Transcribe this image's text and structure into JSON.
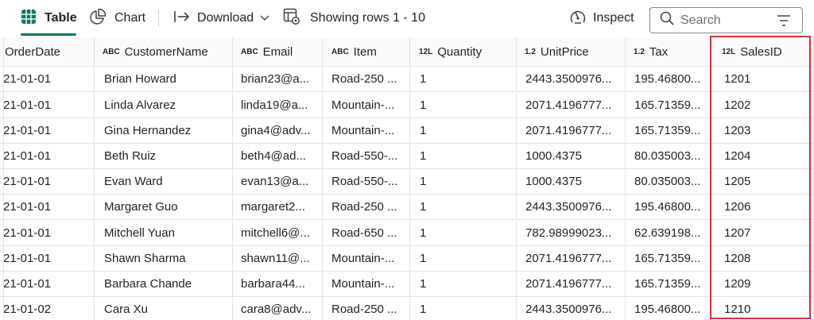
{
  "toolbar": {
    "table_label": "Table",
    "chart_label": "Chart",
    "download_label": "Download",
    "rows_label": "Showing rows 1 - 10",
    "inspect_label": "Inspect",
    "search_placeholder": "Search",
    "accent_color": "#117865"
  },
  "columns": [
    {
      "type": "",
      "name": "OrderDate"
    },
    {
      "type": "ABC",
      "name": "CustomerName"
    },
    {
      "type": "ABC",
      "name": "Email"
    },
    {
      "type": "ABC",
      "name": "Item"
    },
    {
      "type": "12L",
      "name": "Quantity"
    },
    {
      "type": "1.2",
      "name": "UnitPrice"
    },
    {
      "type": "1.2",
      "name": "Tax"
    },
    {
      "type": "12L",
      "name": "SalesID"
    }
  ],
  "rows": [
    [
      "21-01-01",
      "Brian Howard",
      "brian23@a...",
      "Road-250 ...",
      "1",
      "2443.3500976...",
      "195.46800...",
      "1201"
    ],
    [
      "21-01-01",
      "Linda Alvarez",
      "linda19@a...",
      "Mountain-...",
      "1",
      "2071.4196777...",
      "165.71359...",
      "1202"
    ],
    [
      "21-01-01",
      "Gina Hernandez",
      "gina4@adv...",
      "Mountain-...",
      "1",
      "2071.4196777...",
      "165.71359...",
      "1203"
    ],
    [
      "21-01-01",
      "Beth Ruiz",
      "beth4@ad...",
      "Road-550-...",
      "1",
      "1000.4375",
      "80.035003...",
      "1204"
    ],
    [
      "21-01-01",
      "Evan Ward",
      "evan13@a...",
      "Road-550-...",
      "1",
      "1000.4375",
      "80.035003...",
      "1205"
    ],
    [
      "21-01-01",
      "Margaret Guo",
      "margaret2...",
      "Road-250 ...",
      "1",
      "2443.3500976...",
      "195.46800...",
      "1206"
    ],
    [
      "21-01-01",
      "Mitchell Yuan",
      "mitchell6@...",
      "Road-650 ...",
      "1",
      "782.98999023...",
      "62.639198...",
      "1207"
    ],
    [
      "21-01-01",
      "Shawn Sharma",
      "shawn11@...",
      "Mountain-...",
      "1",
      "2071.4196777...",
      "165.71359...",
      "1208"
    ],
    [
      "21-01-01",
      "Barbara Chande",
      "barbara44...",
      "Mountain-...",
      "1",
      "2071.4196777...",
      "165.71359...",
      "1209"
    ],
    [
      "21-01-02",
      "Cara Xu",
      "cara8@adv...",
      "Road-250 ...",
      "1",
      "2443.3500976...",
      "195.46800...",
      "1210"
    ]
  ],
  "highlight_color": "#d13438"
}
